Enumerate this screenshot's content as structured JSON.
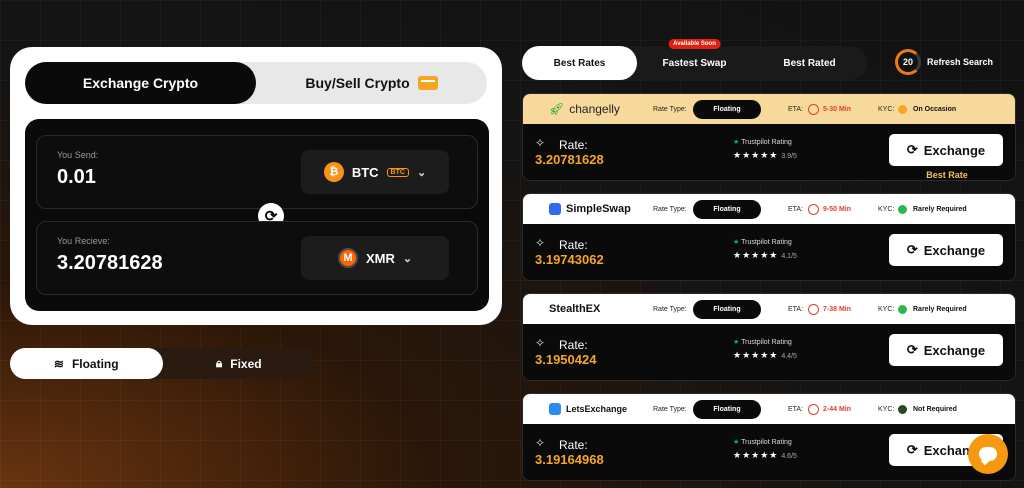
{
  "left": {
    "tabs": [
      {
        "label": "Exchange Crypto"
      },
      {
        "label": "Buy/Sell Crypto"
      }
    ],
    "send": {
      "label": "You Send:",
      "value": "0.01",
      "coin": "BTC",
      "network": "BTC"
    },
    "receive": {
      "label": "You Recieve:",
      "value": "3.20781628",
      "coin": "XMR"
    },
    "rate_modes": [
      {
        "label": "Floating"
      },
      {
        "label": "Fixed"
      }
    ]
  },
  "right": {
    "tabs": [
      {
        "label": "Best Rates"
      },
      {
        "label": "Fastest Swap",
        "badge": "Available Soon"
      },
      {
        "label": "Best Rated"
      }
    ],
    "refresh": {
      "timer": "20",
      "label": "Refresh Search"
    },
    "rate_type_label": "Rate Type:",
    "eta_label": "ETA:",
    "kyc_label": "KYC:",
    "rate_label": "Rate:",
    "trustpilot_label": "Trustpilot Rating",
    "exchange_label": "Exchange",
    "best_rate_label": "Best Rate",
    "offers": [
      {
        "provider": "changelly",
        "rate_type": "Floating",
        "eta": "5-30 Min",
        "kyc": "On Occasion",
        "kyc_color": "#f5a623",
        "rate": "3.20781628",
        "stars": "★★★★★",
        "score": "3.9/5"
      },
      {
        "provider": "SimpleSwap",
        "rate_type": "Floating",
        "eta": "9-50 Min",
        "kyc": "Rarely Required",
        "kyc_color": "#2db84d",
        "rate": "3.19743062",
        "stars": "★★★★★",
        "score": "4.1/5"
      },
      {
        "provider": "StealthEX",
        "rate_type": "Floating",
        "eta": "7-38 Min",
        "kyc": "Rarely Required",
        "kyc_color": "#2db84d",
        "rate": "3.1950424",
        "stars": "★★★★★",
        "score": "4.4/5"
      },
      {
        "provider": "LetsExchange",
        "rate_type": "Floating",
        "eta": "2-44 Min",
        "kyc": "Not Required",
        "kyc_color": "#1f4d1f",
        "rate": "3.19164968",
        "stars": "★★★★★",
        "score": "4.6/5"
      }
    ]
  }
}
